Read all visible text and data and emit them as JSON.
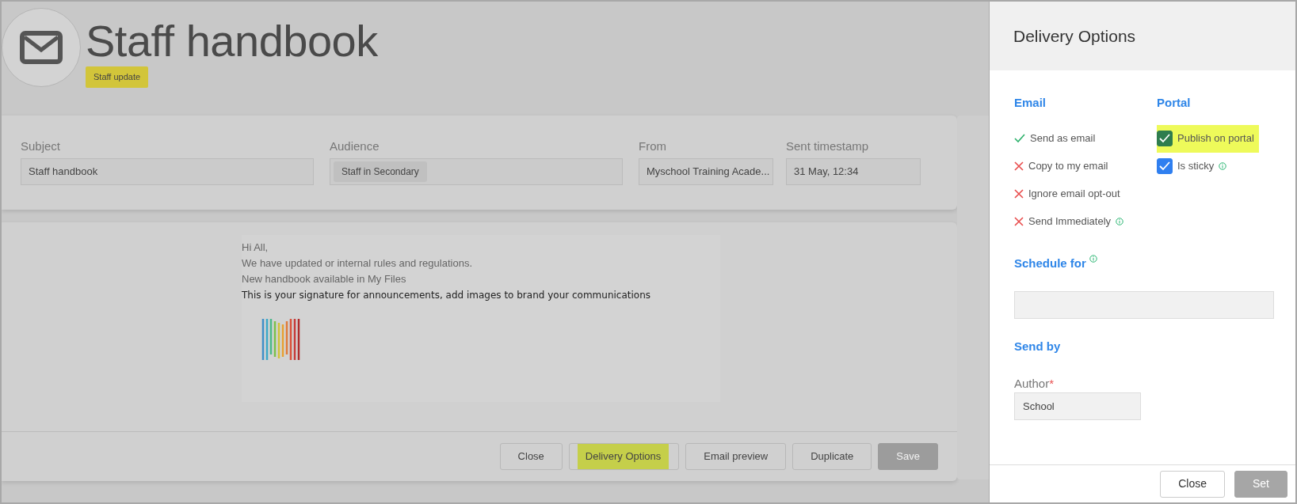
{
  "header": {
    "title": "Staff handbook",
    "tag": "Staff update"
  },
  "fields": [
    {
      "label": "Subject",
      "value": "Staff handbook",
      "kind": "text"
    },
    {
      "label": "Audience",
      "value": "Staff in Secondary",
      "kind": "chip"
    },
    {
      "label": "From",
      "value": "Myschool Training Acade...",
      "kind": "text"
    },
    {
      "label": "Sent timestamp",
      "value": "31 May, 12:34",
      "kind": "text"
    }
  ],
  "message": {
    "lines": [
      "Hi All,",
      "We have updated or internal rules and regulations.",
      "New handbook available in My Files"
    ],
    "signature": "This is your signature for announcements, add images to brand your communications"
  },
  "footer_buttons": [
    {
      "label": "Close",
      "highlighted": false,
      "disabled": false
    },
    {
      "label": "Delivery Options",
      "highlighted": true,
      "disabled": false
    },
    {
      "label": "Email preview",
      "highlighted": false,
      "disabled": false
    },
    {
      "label": "Duplicate",
      "highlighted": false,
      "disabled": false
    },
    {
      "label": "Save",
      "highlighted": false,
      "disabled": true
    }
  ],
  "delivery_panel": {
    "title": "Delivery Options",
    "email": {
      "heading": "Email",
      "options": [
        {
          "label": "Send as email",
          "checked": true,
          "info": false
        },
        {
          "label": "Copy to my email",
          "checked": false,
          "info": false
        },
        {
          "label": "Ignore email opt-out",
          "checked": false,
          "info": false
        },
        {
          "label": "Send Immediately",
          "checked": false,
          "info": true
        }
      ]
    },
    "portal": {
      "heading": "Portal",
      "options": [
        {
          "label": "Publish on portal",
          "checked": true,
          "highlighted": true,
          "info": false
        },
        {
          "label": "Is sticky",
          "checked": true,
          "highlighted": false,
          "info": true
        }
      ]
    },
    "schedule": {
      "heading": "Schedule for",
      "info": true
    },
    "send_by": {
      "heading": "Send by",
      "author_label": "Author",
      "required_mark": "*",
      "author_value": "School"
    },
    "buttons": [
      {
        "label": "Close",
        "disabled": false
      },
      {
        "label": "Set",
        "disabled": true
      }
    ]
  }
}
